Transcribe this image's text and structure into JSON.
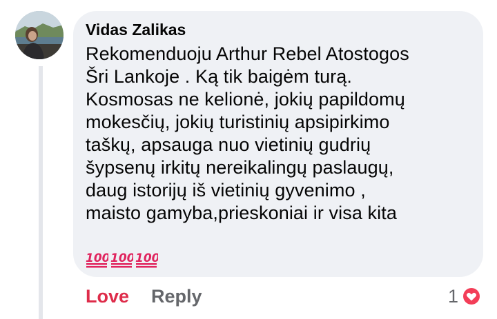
{
  "comment": {
    "author": "Vidas Zalikas",
    "text_lines": [
      "Rekomenduoju Arthur Rebel Atostogos",
      "Šri Lankoje . Ką tik baigėm turą.",
      "Kosmosas ne kelionė, jokių papildomų",
      "mokesčių, jokių turistinių apsipirkimo",
      "taškų, apsauga nuo vietinių gudrių",
      "šypsenų irkitų nereikalingų paslaugų,",
      "daug istorijų iš vietinių gyvenimo ,",
      "maisto gamyba,prieskoniai ir visa kita"
    ],
    "emojis": [
      "hundred-points-icon",
      "hundred-points-icon",
      "hundred-points-icon"
    ]
  },
  "actions": {
    "love_label": "Love",
    "reply_label": "Reply"
  },
  "reactions": {
    "count": "1",
    "icon": "heart-icon"
  },
  "colors": {
    "bubble": "#eff1f5",
    "love": "#de2c4a",
    "muted": "#65676b",
    "heart": "#f33e58"
  }
}
